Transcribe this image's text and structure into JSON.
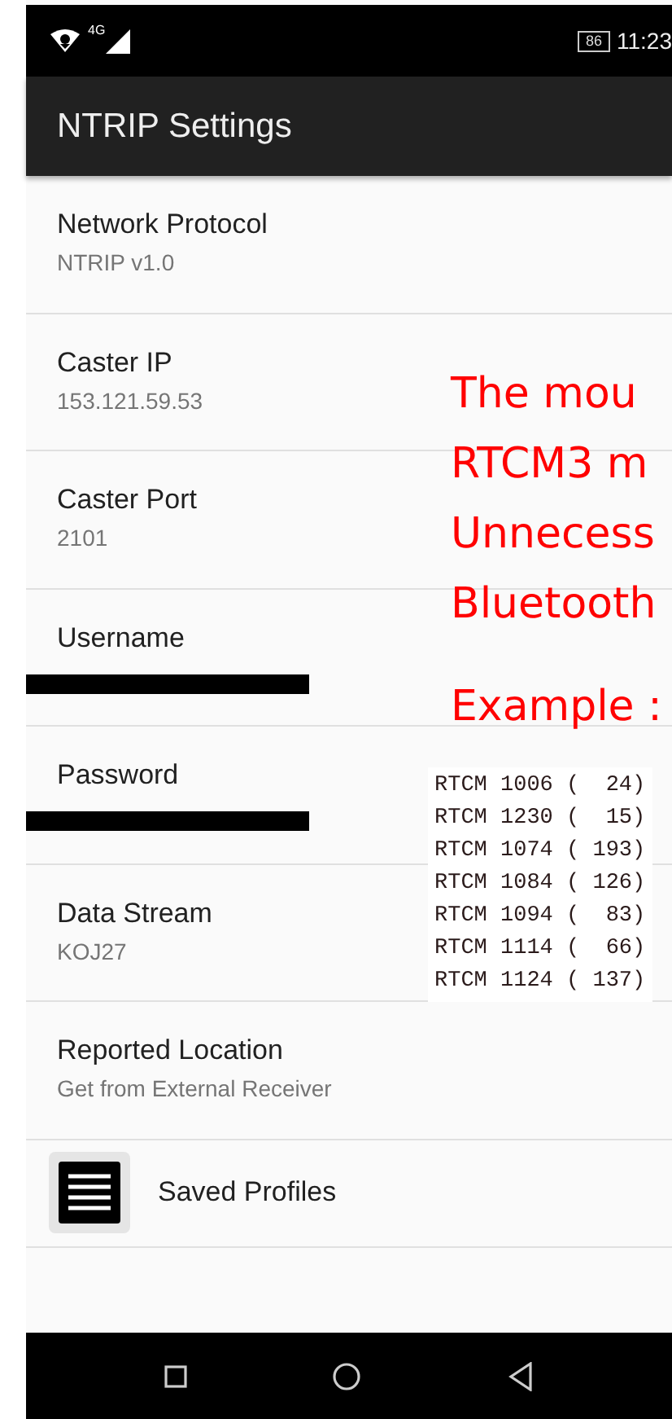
{
  "status_bar": {
    "network": "4G",
    "battery": "86",
    "time": "11:23"
  },
  "app_bar": {
    "title": "NTRIP Settings"
  },
  "settings": [
    {
      "kind": "text",
      "title": "Network Protocol",
      "value": "NTRIP v1.0"
    },
    {
      "kind": "text",
      "title": "Caster IP",
      "value": "153.121.59.53"
    },
    {
      "kind": "text",
      "title": "Caster Port",
      "value": "2101"
    },
    {
      "kind": "redacted",
      "title": "Username"
    },
    {
      "kind": "redacted",
      "title": "Password"
    },
    {
      "kind": "text",
      "title": "Data Stream",
      "value": "KOJ27"
    },
    {
      "kind": "text",
      "title": "Reported Location",
      "value": "Get from External Receiver"
    },
    {
      "kind": "icon",
      "title": "Saved Profiles"
    }
  ],
  "annotation": {
    "lines": [
      "The mou",
      "RTCM3 m",
      "Unnecess",
      "Bluetooth"
    ],
    "example_label": "Example :",
    "example_lines": [
      "RTCM 1006 (  24)",
      "RTCM 1230 (  15)",
      "RTCM 1074 ( 193)",
      "RTCM 1084 ( 126)",
      "RTCM 1094 (  83)",
      "RTCM 1114 (  66)",
      "RTCM 1124 ( 137)"
    ]
  }
}
